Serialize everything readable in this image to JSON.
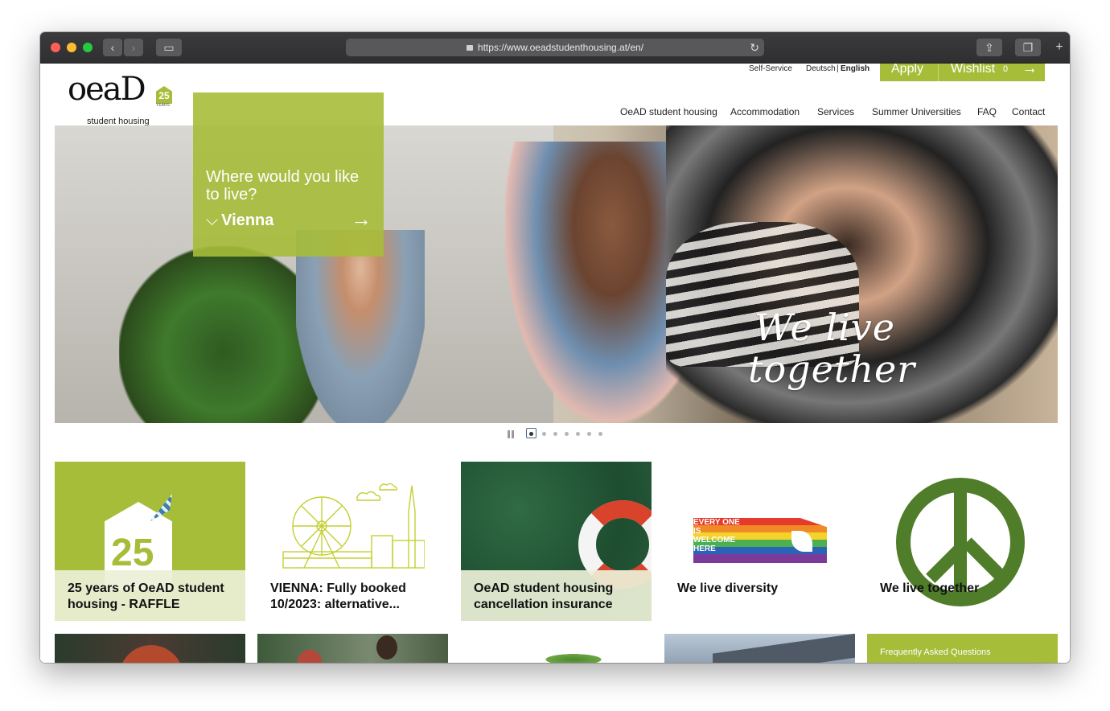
{
  "browser": {
    "url": "https://www.oeadstudenthousing.at/en/"
  },
  "brand": {
    "logo_text": "oeaD",
    "badge": "25",
    "badge_sub": "YEARS",
    "tagline": "student housing",
    "accent_color": "#a6bd3a"
  },
  "utility": {
    "self_service": "Self-Service",
    "lang_de": "Deutsch",
    "lang_sep": "|",
    "lang_en": "English",
    "apply": "Apply",
    "wishlist": "Wishlist",
    "wishlist_count": "0"
  },
  "nav": {
    "items": [
      "OeAD student housing",
      "Accommodation",
      "Services",
      "Summer Universities",
      "FAQ",
      "Contact"
    ]
  },
  "hero": {
    "question": "Where would you like to live?",
    "city": "Vienna",
    "script_line1": "We live",
    "script_line2": "together",
    "slides_total": 7,
    "slides_active": 1
  },
  "cards": [
    {
      "title": "25 years of OeAD student housing - RAFFLE",
      "badge": "25"
    },
    {
      "title": "VIENNA: Fully booked 10/2023: alternative..."
    },
    {
      "title": "OeAD student housing cancellation insurance"
    },
    {
      "title": "We live diversity",
      "flag_text": "EVERY ONE IS WELCOME HERE"
    },
    {
      "title": "We live together"
    }
  ],
  "faq": {
    "label": "Frequently Asked Questions"
  }
}
